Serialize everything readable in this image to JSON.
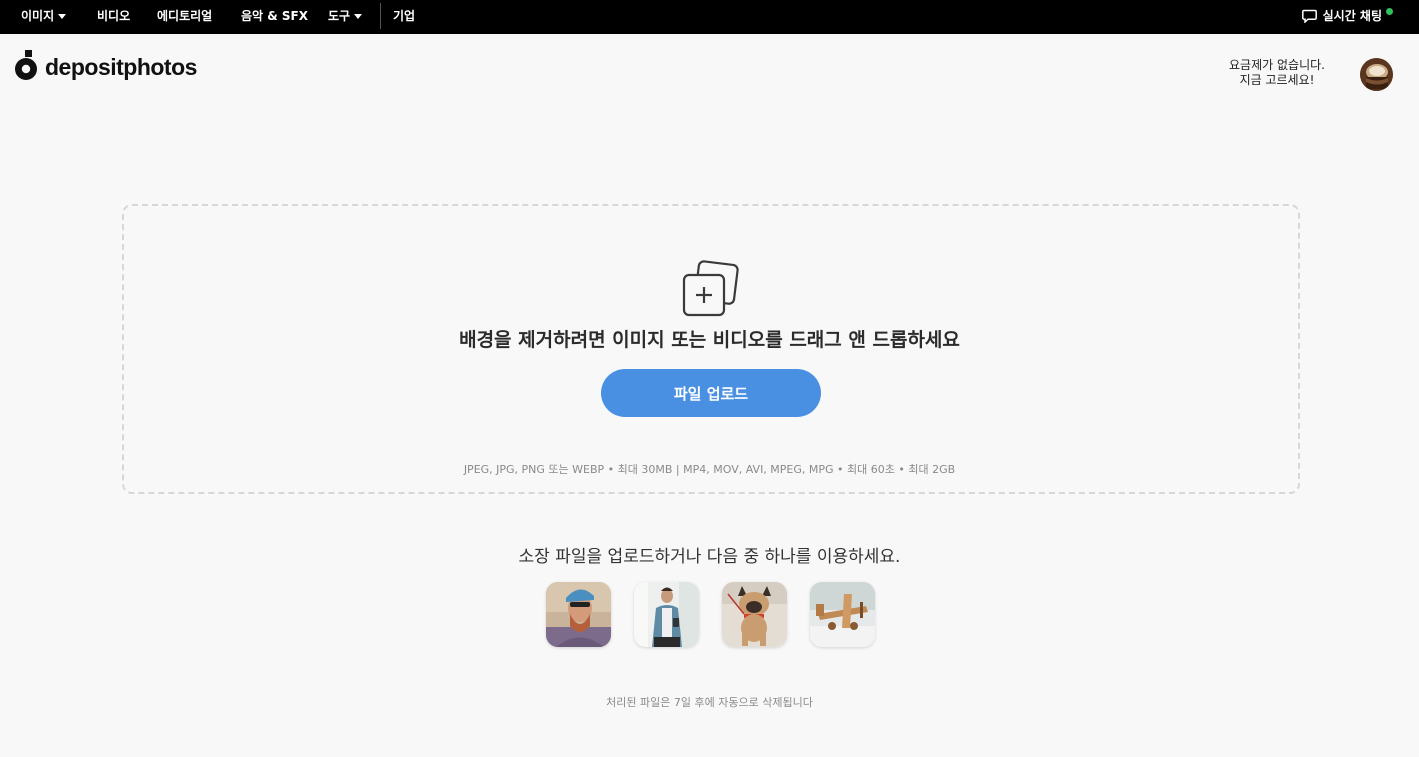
{
  "topnav": {
    "items": [
      {
        "label": "이미지",
        "dropdown": true
      },
      {
        "label": "비디오",
        "dropdown": false
      },
      {
        "label": "에디토리얼",
        "dropdown": false
      },
      {
        "label": "음악 & SFX",
        "dropdown": false
      },
      {
        "label": "도구",
        "dropdown": true
      },
      {
        "label": "기업",
        "dropdown": false
      }
    ],
    "chat_label": "실시간 채팅",
    "chat_status_color": "#2fc25b"
  },
  "header": {
    "logo_text": "depositphotos",
    "plan_line1": "요금제가 없습니다.",
    "plan_line2": "지금 고르세요!"
  },
  "dropzone": {
    "title": "배경을 제거하려면 이미지 또는 비디오를 드래그 앤 드롭하세요",
    "upload_button": "파일 업로드",
    "formats": "JPEG, JPG, PNG 또는 WEBP • 최대 30MB | MP4, MOV, AVI, MPEG, MPG • 최대 60초 • 최대 2GB",
    "accent_color": "#4a90e2"
  },
  "samples": {
    "title": "소장 파일을 업로드하거나 다음 중 하나를 이용하세요."
  },
  "footer": {
    "auto_delete": "처리된 파일은 7일 후에 자동으로 삭제됩니다"
  }
}
